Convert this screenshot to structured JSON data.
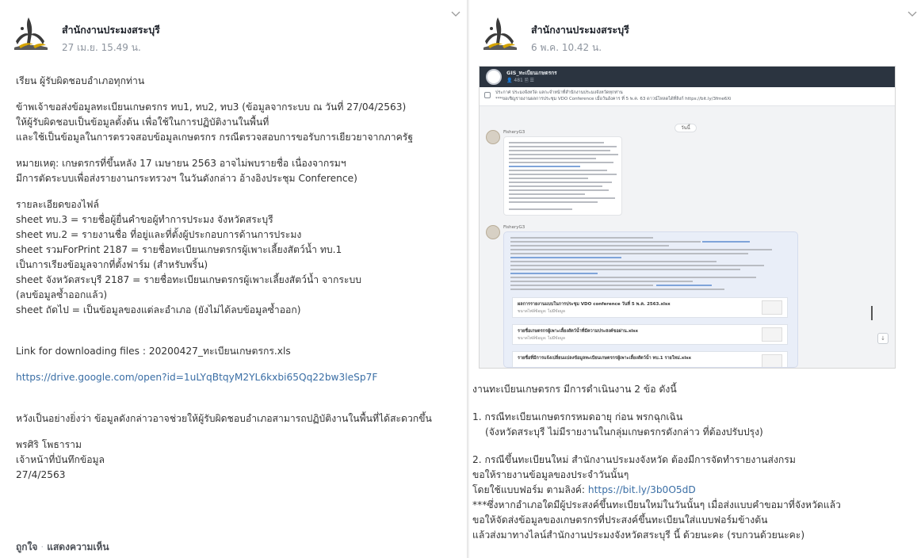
{
  "left_post": {
    "page_name": "สำนักงานประมงสระบุรี",
    "time": "27 เม.ย. 15.49 น.",
    "greeting": "เรียน ผู้รับผิดชอบอำเภอทุกท่าน",
    "intro_lines": [
      "ข้าพเจ้าขอส่งข้อมูลทะเบียนเกษตรกร ทบ1, ทบ2, ทบ3 (ข้อมูลจากระบบ ณ วันที่ 27/04/2563)",
      "ให้ผู้รับผิดชอบเป็นข้อมูลตั้งต้น เพื่อใช้ในการปฏิบัติงานในพื้นที่",
      "และใช้เป็นข้อมูลในการตรวจสอบข้อมูลเกษตรกร กรณีตรวจสอบการขอรับการเยียวยาจากภาครัฐ"
    ],
    "note_lines": [
      "หมายเหตุ: เกษตรกรที่ขึ้นหลัง 17 เมษายน 2563 อาจไม่พบรายชื่อ เนื่องจากรมฯ",
      "มีการตัดระบบเพื่อส่งรายงานกระทรวงฯ ในวันดังกล่าว อ้างอิงประชุม Conference)"
    ],
    "detail_lines": [
      "รายละเอียดของไฟล์",
      "sheet ทบ.3 = รายชื่อผู้ยื่นคำขอผู้ทำการประมง จังหวัดสระบุรี",
      "sheet ทบ.2 = รายงานชื่อ ที่อยู่และที่ตั้งผู้ประกอบการด้านการประมง",
      "sheet รวมForPrint 2187 = รายชื่อทะเบียนเกษตรกรผู้เพาะเลี้ยงสัตว์น้ำ ทบ.1",
      "เป็นการเรียงข้อมูลจากที่ตั้งฟาร์ม (สำหรับพริ้น)",
      "sheet จังหวัดสระบุรี 2187 = รายชื่อทะเบียนเกษตรกรผู้เพาะเลี้ยงสัตว์น้ำ จากระบบ",
      "(ลบข้อมูลซ้ำออกแล้ว)",
      "sheet ถัดไป = เป็นข้อมูลของแต่ละอำเภอ (ยังไม่ได้ลบข้อมูลซ้ำออก)"
    ],
    "download_line": "Link for downloading files : 20200427_ทะเบียนเกษตรกร.xls",
    "drive_link": "https://drive.google.com/open?id=1uLYqBtqyM2YL6kxbi65Qq22bw3leSp7F",
    "closing": "หวังเป็นอย่างยิ่งว่า ข้อมูลดังกล่าวอาจช่วยให้ผู้รับผิดชอบอำเภอสามารถปฏิบัติงานในพื้นที่ได้สะดวกขึ้น",
    "signature_lines": [
      "พรศิริ โพธาราม",
      "เจ้าหน้าที่บันทึกข้อมูล",
      "27/4/2563"
    ],
    "like_label": "ถูกใจ",
    "action_sep": "·",
    "comment_label": "แสดงความเห็น"
  },
  "right_post": {
    "page_name": "สำนักงานประมงสระบุรี",
    "time": "6 พ.ค. 10.42 น.",
    "screenshot": {
      "chat_title": "GIS_ทะเบียนเกษตรกร",
      "chat_sub": "👤 481  🗎  ☰",
      "pinned_text_1": "ประกาศ ประมงจังหวัด แลกะจำหน้าที่สำนักงานประมงจังหวัดทุกท่าน",
      "pinned_text_2": "***ขอเชิญรายงานผลการประชุม VDO Conference เมื่อวันอังคาร ที่ 5 พ.ค. 63 ดาวน์โหลดได้ที่ลิงก์ https://bit.ly/3fme6Xi",
      "date_chip": "วันนี้",
      "sender_1": "FisheryG3",
      "sender_2": "FisheryG3",
      "file_1": "ผลการรายงานแบบในการประชุม VDO conference วันที่ 5 พ.ค. 2563.xlsx",
      "file_1_sub": "ขนาดไฟล์ข้อมูล: ไม่มีข้อมูล",
      "file_2": "รายชื่อเกษตรกรผู้เพาะเลี้ยงสัตว์น้ำที่มีความประสงค์ขอผ่าน.xlsx",
      "file_2_sub": "ขนาดไฟล์ข้อมูล: ไม่มีข้อมูล",
      "file_3": "รายชื่อที่มีการแจ้งเปลี่ยนแปลงข้อมูลทะเบียนเกษตรกรผู้เพาะเลี้ยงสัตว์น้ำ ทบ.1 รายใหม่.xlsx",
      "down_arrow": "↓"
    },
    "intro": "งานทะเบียนเกษตรกร มีการดำเนินงาน 2 ข้อ ดังนี้",
    "item1_lines": [
      "1. กรณีทะเบียนเกษตรกรหมดอายุ ก่อน พรกฉุกเฉิน",
      "(จังหวัดสระบุรี ไม่มีรายงานในกลุ่มเกษตรกรดังกล่าว ที่ต้องปรับปรุง)"
    ],
    "item2_lines": [
      "2. กรณีขึ้นทะเบียนใหม่ สำนักงานประมงจังหวัด ต้องมีการจัดทำรายงานส่งกรม",
      "ขอให้รายงานข้อมูลของประจำวันนั้นๆ"
    ],
    "form_prefix": "โดยใช้แบบฟอร์ม ตามลิงค์: ",
    "form_link": "https://bit.ly/3b0O5dD",
    "tail_lines": [
      "***ซึ่งหากอำเภอใดมีผู้ประสงค์ขึ้นทะเบียนใหม่ในวันนั้นๆ เมื่อส่งแบบคำขอมาที่จังหวัดแล้ว",
      "ขอให้จัดส่งข้อมูลของเกษตรกรที่ประสงค์ขึ้นทะเบียนใส่แบบฟอร์มข้างต้น",
      "แล้วส่งมาทางไลน์สำนักงานประมงจังหวัดสระบุรี นี้ ด้วยนะคะ (รบกวนด้วยนะคะ)"
    ]
  },
  "icons": {
    "collapse": "chevron-down-icon",
    "logo": "fisheries-logo-icon"
  },
  "colors": {
    "link": "#3a6ea5",
    "name": "#1d2129",
    "meta": "#8d949e"
  }
}
